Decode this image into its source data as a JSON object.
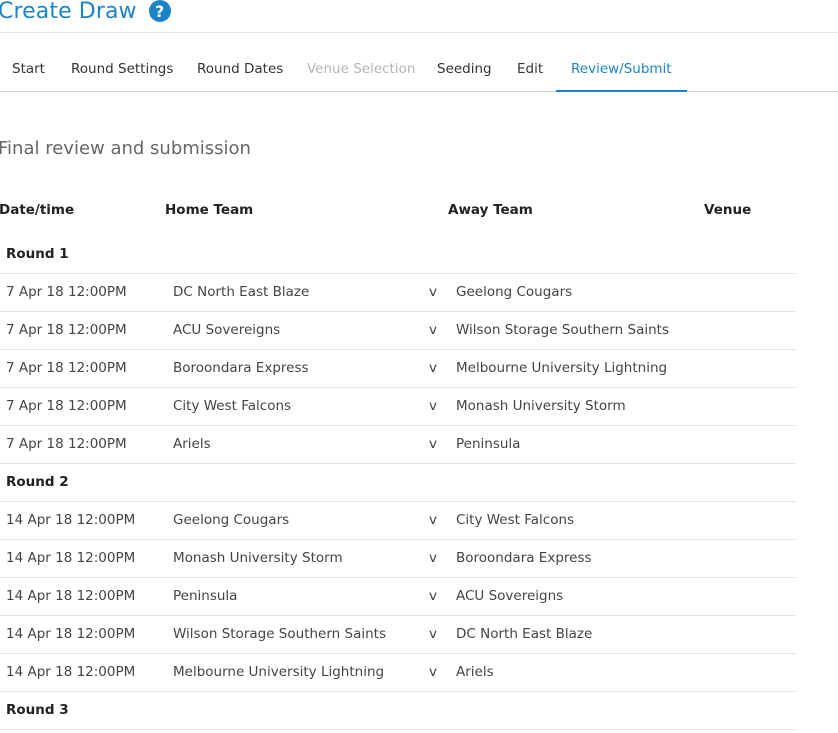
{
  "header": {
    "title": "Create Draw",
    "help_icon": "?"
  },
  "tabs": [
    {
      "label": "Start",
      "state": "normal"
    },
    {
      "label": "Round Settings",
      "state": "normal"
    },
    {
      "label": "Round Dates",
      "state": "normal"
    },
    {
      "label": "Venue Selection",
      "state": "disabled"
    },
    {
      "label": "Seeding",
      "state": "normal"
    },
    {
      "label": "Edit",
      "state": "normal"
    },
    {
      "label": "Review/Submit",
      "state": "active"
    }
  ],
  "section": {
    "title": "Final review and submission"
  },
  "columns": {
    "date": "Date/time",
    "home": "Home Team",
    "away": "Away Team",
    "venue": "Venue"
  },
  "rounds": [
    {
      "label": "Round 1",
      "matches": [
        {
          "date": "7 Apr 18 12:00PM",
          "home": "DC North East Blaze",
          "vs": "v",
          "away": "Geelong Cougars",
          "venue": ""
        },
        {
          "date": "7 Apr 18 12:00PM",
          "home": "ACU Sovereigns",
          "vs": "v",
          "away": "Wilson Storage Southern Saints",
          "venue": ""
        },
        {
          "date": "7 Apr 18 12:00PM",
          "home": "Boroondara Express",
          "vs": "v",
          "away": "Melbourne University Lightning",
          "venue": ""
        },
        {
          "date": "7 Apr 18 12:00PM",
          "home": "City West Falcons",
          "vs": "v",
          "away": "Monash University Storm",
          "venue": ""
        },
        {
          "date": "7 Apr 18 12:00PM",
          "home": "Ariels",
          "vs": "v",
          "away": "Peninsula",
          "venue": ""
        }
      ]
    },
    {
      "label": "Round 2",
      "matches": [
        {
          "date": "14 Apr 18 12:00PM",
          "home": "Geelong Cougars",
          "vs": "v",
          "away": "City West Falcons",
          "venue": ""
        },
        {
          "date": "14 Apr 18 12:00PM",
          "home": "Monash University Storm",
          "vs": "v",
          "away": "Boroondara Express",
          "venue": ""
        },
        {
          "date": "14 Apr 18 12:00PM",
          "home": "Peninsula",
          "vs": "v",
          "away": "ACU Sovereigns",
          "venue": ""
        },
        {
          "date": "14 Apr 18 12:00PM",
          "home": "Wilson Storage Southern Saints",
          "vs": "v",
          "away": "DC North East Blaze",
          "venue": ""
        },
        {
          "date": "14 Apr 18 12:00PM",
          "home": "Melbourne University Lightning",
          "vs": "v",
          "away": "Ariels",
          "venue": ""
        }
      ]
    },
    {
      "label": "Round 3",
      "matches": []
    }
  ],
  "colors": {
    "accent": "#1c84c6",
    "disabled": "#b5b5b5",
    "divider": "#e4e4e4"
  }
}
